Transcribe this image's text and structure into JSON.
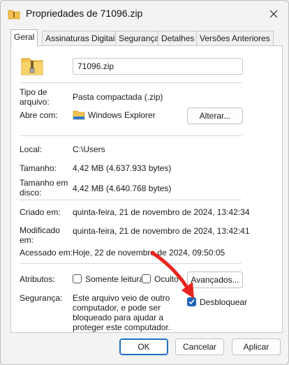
{
  "window": {
    "title": "Propriedades de 71096.zip"
  },
  "tabs": [
    "Geral",
    "Assinaturas Digitais",
    "Segurança",
    "Detalhes",
    "Versões Anteriores"
  ],
  "general": {
    "file_name": "71096.zip",
    "type_label": "Tipo de arquivo:",
    "type_label_line1": "Tipo de",
    "type_label_line2": "arquivo:",
    "type_value": "Pasta compactada (.zip)",
    "opens_with_label": "Abre com:",
    "opens_with_value": "Windows Explorer",
    "change_button": "Alterar...",
    "location_label": "Local:",
    "location_value": "C:\\Users",
    "size_label": "Tamanho:",
    "size_value": "4,42 MB (4.637.933 bytes)",
    "disk_size_label_line1": "Tamanho em",
    "disk_size_label_line2": "disco:",
    "disk_size_value": "4,42 MB (4.640.768 bytes)",
    "created_label": "Criado em:",
    "created_value": "quinta-feira, 21 de novembro de 2024, 13:42:34",
    "modified_label_line1": "Modificado",
    "modified_label_line2": "em:",
    "modified_value": "quinta-feira, 21 de novembro de 2024, 13:42:41",
    "accessed_label": "Acessado em:",
    "accessed_value": "Hoje, 22 de novembro de 2024, 09:50:05",
    "attributes_label": "Atributos:",
    "readonly_label": "Somente leitura",
    "readonly_checked": false,
    "hidden_label": "Oculto",
    "hidden_checked": false,
    "advanced_button": "Avançados...",
    "security_label": "Segurança:",
    "security_text": "Este arquivo veio de outro computador, e pode ser bloqueado para ajudar a proteger este computador.",
    "unblock_label": "Desbloquear",
    "unblock_checked": true
  },
  "footer": {
    "ok": "OK",
    "cancel": "Cancelar",
    "apply": "Aplicar"
  },
  "colors": {
    "accent": "#1f63b8",
    "annotation_arrow": "#e8241c",
    "folder": "#f2c14e"
  },
  "icons": [
    "zip-folder-icon",
    "windows-explorer-folder-icon",
    "close-icon",
    "checkmark-icon",
    "red-arrow-annotation"
  ]
}
